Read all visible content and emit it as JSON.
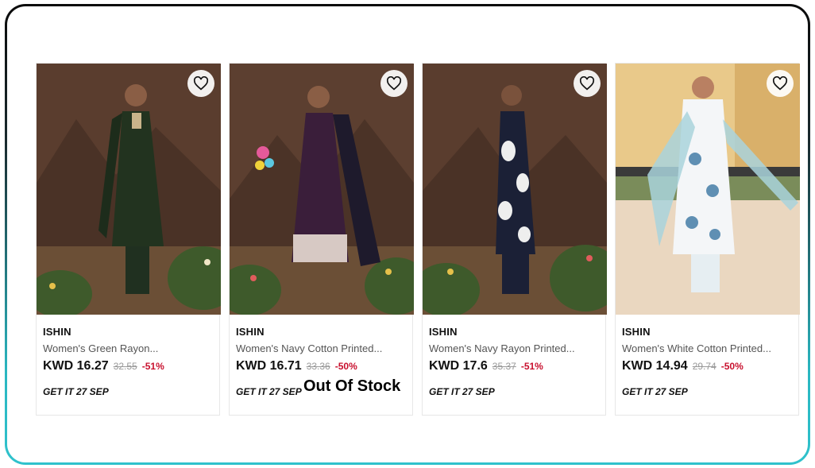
{
  "products": [
    {
      "brand": "ISHIN",
      "title": "Women's Green Rayon...",
      "price": "KWD 16.27",
      "mrp": "32.55",
      "discount": "-51%",
      "delivery": "GET IT 27 SEP",
      "wishlist_icon": "heart-icon"
    },
    {
      "brand": "ISHIN",
      "title": "Women's Navy Cotton Printed...",
      "price": "KWD 16.71",
      "mrp": "33.36",
      "discount": "-50%",
      "delivery": "GET IT 27 SEP",
      "stock_status": "Out Of Stock",
      "wishlist_icon": "heart-icon"
    },
    {
      "brand": "ISHIN",
      "title": "Women's Navy Rayon Printed...",
      "price": "KWD 17.6",
      "mrp": "35.37",
      "discount": "-51%",
      "delivery": "GET IT 27 SEP",
      "wishlist_icon": "heart-icon"
    },
    {
      "brand": "ISHIN",
      "title": "Women's White Cotton Printed...",
      "price": "KWD 14.94",
      "mrp": "29.74",
      "discount": "-50%",
      "delivery": "GET IT 27 SEP",
      "wishlist_icon": "heart-icon"
    }
  ],
  "colors": {
    "discount": "#c8102e",
    "frame_top": "#0b0b0b",
    "frame_bottom": "#2fc2cc"
  }
}
